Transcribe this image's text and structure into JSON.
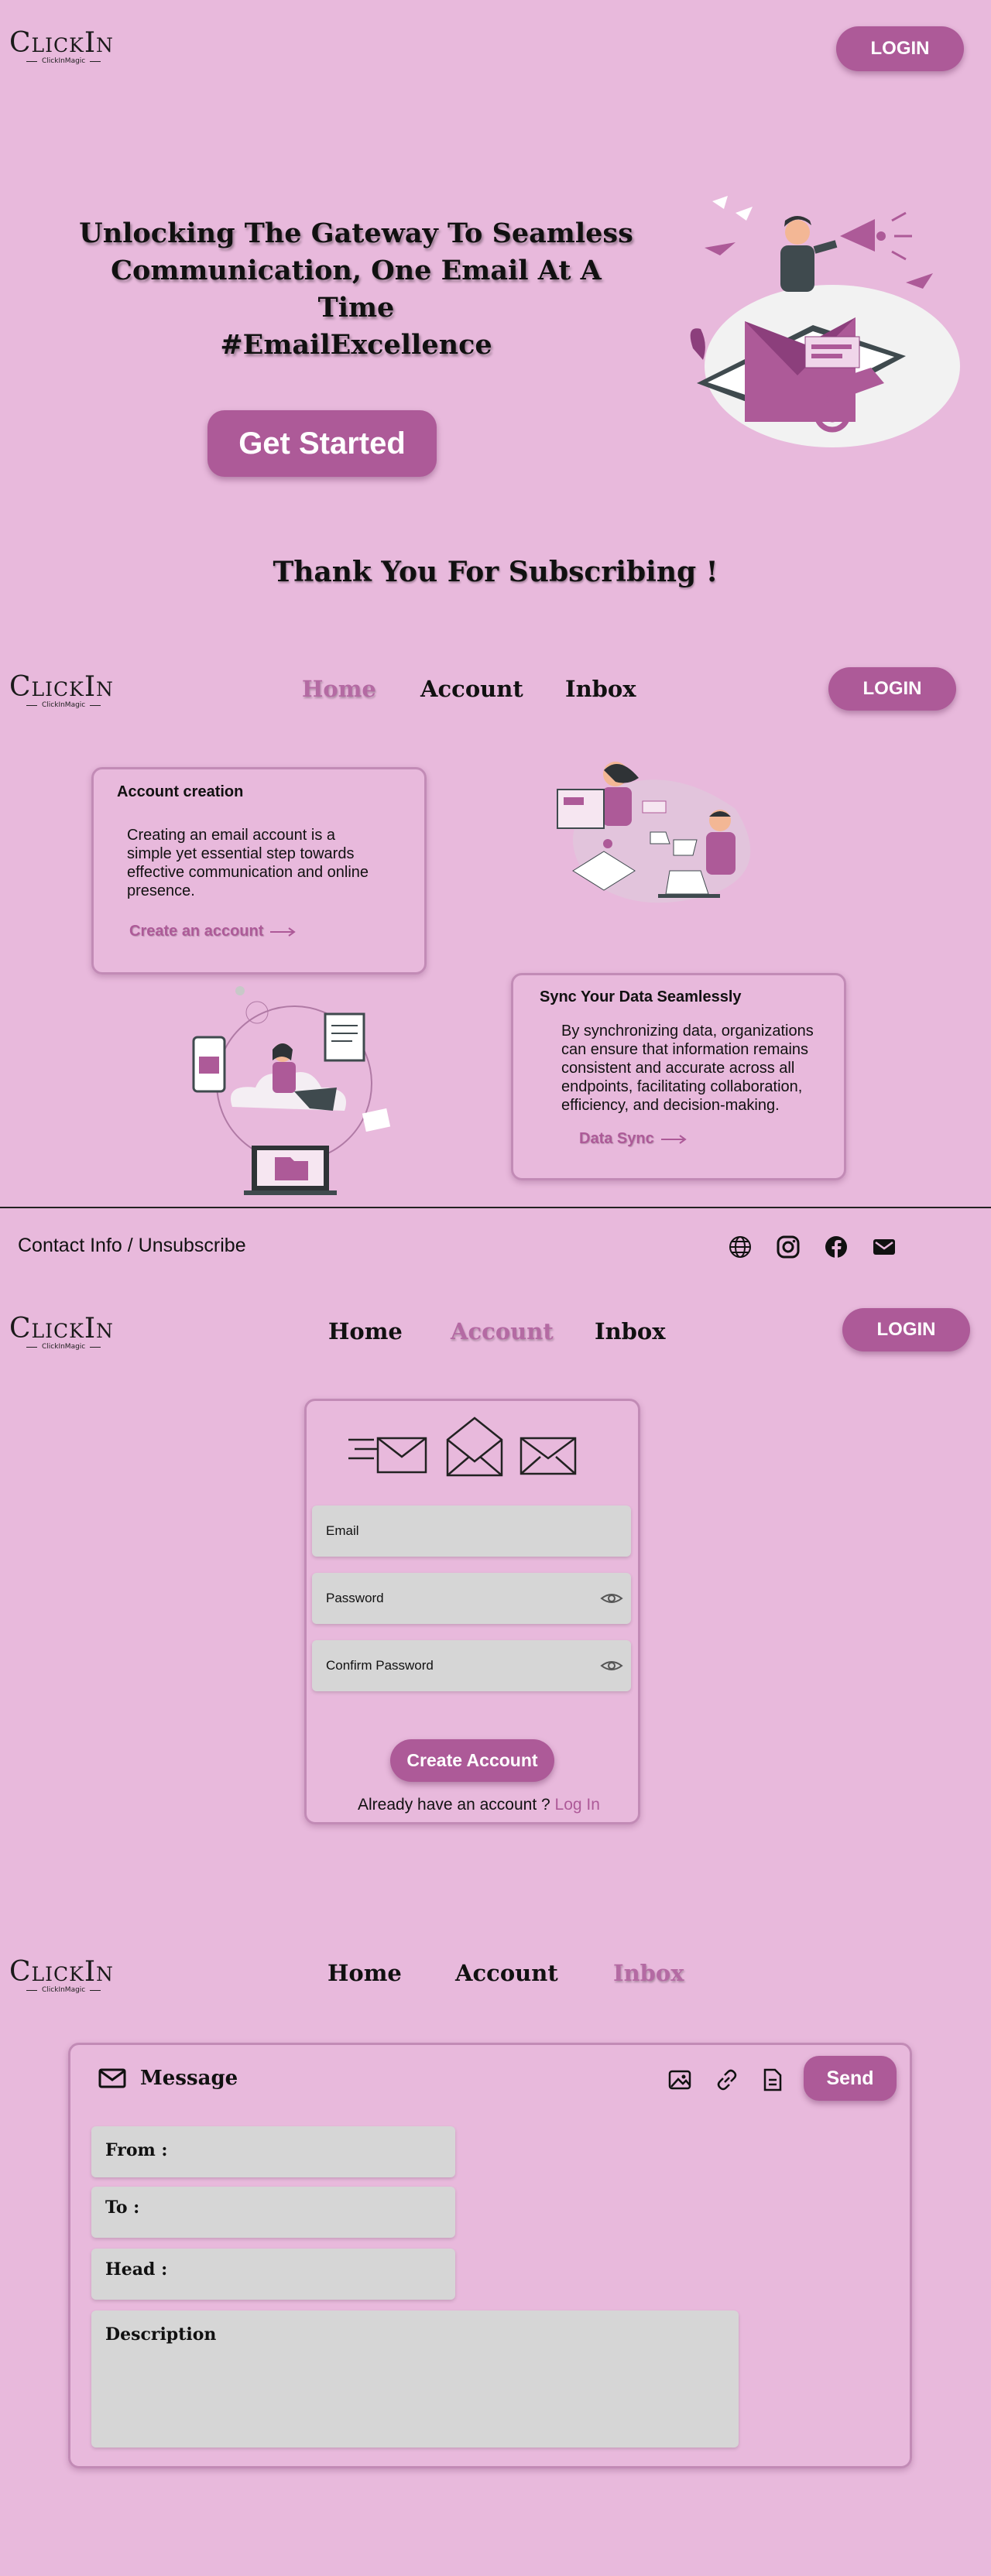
{
  "brand": {
    "logo_text": "ClickIn",
    "logo_subtext": "ClickInMagic"
  },
  "colors": {
    "background": "#e8b9dc",
    "accent": "#ad5a98",
    "field": "#d6d6d6",
    "text": "#111111"
  },
  "landing": {
    "login_label": "LOGIN",
    "hero_line1": "Unlocking The Gateway To Seamless",
    "hero_line2": "Communication, One Email At A",
    "hero_line3": "Time",
    "hero_line4": "#EmailExcellence",
    "cta_label": "Get Started"
  },
  "thanks": {
    "text": "Thank You For Subscribing !"
  },
  "home": {
    "nav": {
      "home": "Home",
      "account": "Account",
      "inbox": "Inbox"
    },
    "login_label": "LOGIN",
    "card1": {
      "title": "Account creation",
      "line1": "Creating an email account is a",
      "line2": "simple yet essential step towards",
      "line3": "effective communication and online",
      "line4": "presence.",
      "link": "Create an account"
    },
    "card2": {
      "title": "Sync Your Data Seamlessly",
      "line1": "By synchronizing data, organizations",
      "line2": "can ensure that information remains",
      "line3": "consistent and accurate across all",
      "line4": "endpoints, facilitating collaboration,",
      "line5": "efficiency, and decision-making.",
      "link": "Data Sync"
    }
  },
  "footer": {
    "text": "Contact Info / Unsubscribe",
    "icons": [
      "globe-icon",
      "instagram-icon",
      "facebook-icon",
      "mail-icon"
    ]
  },
  "account": {
    "nav": {
      "home": "Home",
      "account": "Account",
      "inbox": "Inbox"
    },
    "login_label": "LOGIN",
    "email_placeholder": "Email",
    "password_placeholder": "Password",
    "confirm_placeholder": "Confirm Password",
    "submit_label": "Create Account",
    "have_account": "Already have an account ?",
    "login_link": "Log In"
  },
  "inbox": {
    "nav": {
      "home": "Home",
      "account": "Account",
      "inbox": "Inbox"
    },
    "message_title": "Message",
    "send_label": "Send",
    "from_label": "From :",
    "to_label": "To :",
    "head_label": "Head :",
    "description_label": "Description",
    "toolbar_icons": [
      "image-icon",
      "link-icon",
      "document-icon"
    ]
  }
}
